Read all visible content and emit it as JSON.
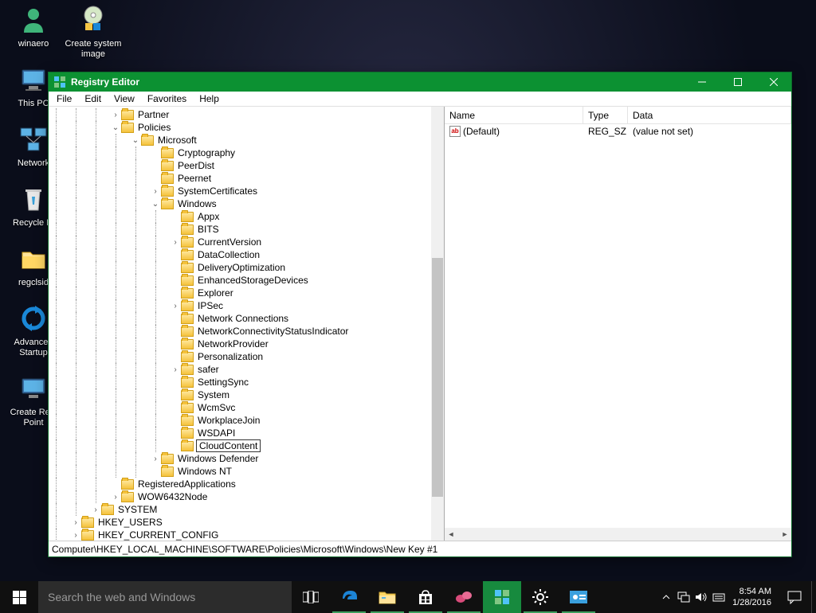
{
  "desktop": {
    "col1": [
      {
        "label": "winaero",
        "icon": "person"
      },
      {
        "label": "This PC",
        "icon": "pc"
      },
      {
        "label": "Network",
        "icon": "network"
      },
      {
        "label": "Recycle Bi",
        "icon": "recycle"
      },
      {
        "label": "regclsid",
        "icon": "folder"
      },
      {
        "label": "Advanced Startup",
        "icon": "sync"
      },
      {
        "label": "Create Rest Point",
        "icon": "pc2"
      }
    ],
    "col2": [
      {
        "label": "Create system image",
        "icon": "cd"
      }
    ]
  },
  "window": {
    "title": "Registry Editor",
    "menu": [
      "File",
      "Edit",
      "View",
      "Favorites",
      "Help"
    ],
    "tree": [
      {
        "d": 3,
        "e": "r",
        "t": "Partner"
      },
      {
        "d": 3,
        "e": "d",
        "t": "Policies"
      },
      {
        "d": 4,
        "e": "d",
        "t": "Microsoft"
      },
      {
        "d": 5,
        "e": " ",
        "t": "Cryptography"
      },
      {
        "d": 5,
        "e": " ",
        "t": "PeerDist"
      },
      {
        "d": 5,
        "e": " ",
        "t": "Peernet"
      },
      {
        "d": 5,
        "e": "r",
        "t": "SystemCertificates"
      },
      {
        "d": 5,
        "e": "d",
        "t": "Windows"
      },
      {
        "d": 6,
        "e": " ",
        "t": "Appx"
      },
      {
        "d": 6,
        "e": " ",
        "t": "BITS"
      },
      {
        "d": 6,
        "e": "r",
        "t": "CurrentVersion"
      },
      {
        "d": 6,
        "e": " ",
        "t": "DataCollection"
      },
      {
        "d": 6,
        "e": " ",
        "t": "DeliveryOptimization"
      },
      {
        "d": 6,
        "e": " ",
        "t": "EnhancedStorageDevices"
      },
      {
        "d": 6,
        "e": " ",
        "t": "Explorer"
      },
      {
        "d": 6,
        "e": "r",
        "t": "IPSec"
      },
      {
        "d": 6,
        "e": " ",
        "t": "Network Connections"
      },
      {
        "d": 6,
        "e": " ",
        "t": "NetworkConnectivityStatusIndicator"
      },
      {
        "d": 6,
        "e": " ",
        "t": "NetworkProvider"
      },
      {
        "d": 6,
        "e": " ",
        "t": "Personalization"
      },
      {
        "d": 6,
        "e": "r",
        "t": "safer"
      },
      {
        "d": 6,
        "e": " ",
        "t": "SettingSync"
      },
      {
        "d": 6,
        "e": " ",
        "t": "System"
      },
      {
        "d": 6,
        "e": " ",
        "t": "WcmSvc"
      },
      {
        "d": 6,
        "e": " ",
        "t": "WorkplaceJoin"
      },
      {
        "d": 6,
        "e": " ",
        "t": "WSDAPI"
      },
      {
        "d": 6,
        "e": " ",
        "t": "CloudContent",
        "edit": true
      },
      {
        "d": 5,
        "e": "r",
        "t": "Windows Defender"
      },
      {
        "d": 5,
        "e": " ",
        "t": "Windows NT"
      },
      {
        "d": 3,
        "e": " ",
        "t": "RegisteredApplications"
      },
      {
        "d": 3,
        "e": "r",
        "t": "WOW6432Node"
      },
      {
        "d": 2,
        "e": "r",
        "t": "SYSTEM"
      },
      {
        "d": 1,
        "e": "r",
        "t": "HKEY_USERS"
      },
      {
        "d": 1,
        "e": "r",
        "t": "HKEY_CURRENT_CONFIG"
      }
    ],
    "list": {
      "cols": [
        "Name",
        "Type",
        "Data"
      ],
      "rows": [
        {
          "name": "(Default)",
          "type": "REG_SZ",
          "data": "(value not set)"
        }
      ]
    },
    "status": "Computer\\HKEY_LOCAL_MACHINE\\SOFTWARE\\Policies\\Microsoft\\Windows\\New Key #1"
  },
  "taskbar": {
    "search_placeholder": "Search the web and Windows",
    "clock_time": "8:54 AM",
    "clock_date": "1/28/2016"
  }
}
